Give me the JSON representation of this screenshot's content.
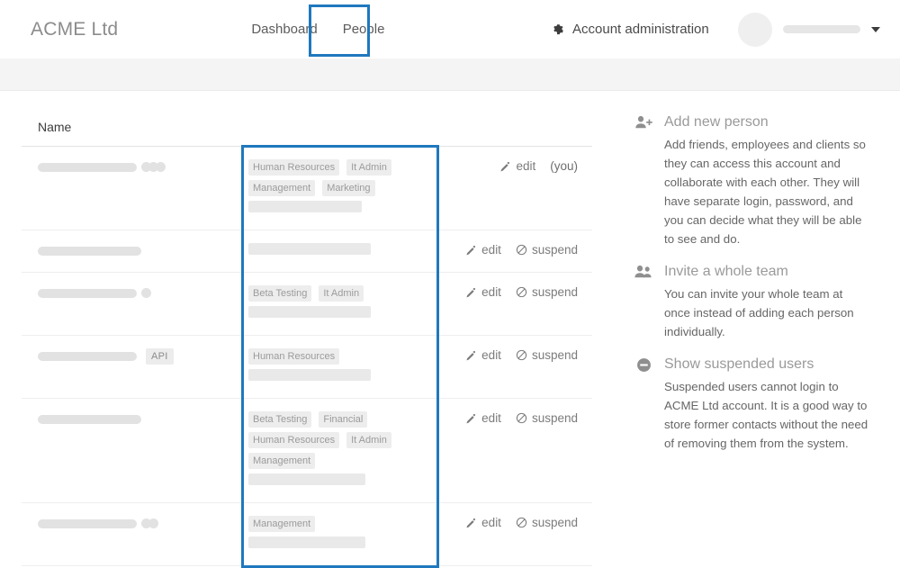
{
  "header": {
    "brand": "ACME Ltd",
    "nav": [
      {
        "label": "Dashboard",
        "active": false
      },
      {
        "label": "People",
        "active": true
      }
    ],
    "account_admin": {
      "label": "Account administration",
      "icon": "gear-icon"
    },
    "user_menu": {
      "avatar": "avatar",
      "name_redacted": true,
      "caret": "chevron-down-icon"
    }
  },
  "table": {
    "columns": [
      "Name"
    ],
    "rows": [
      {
        "name_redacted": true,
        "name_bar_width": 110,
        "name_dots": 3,
        "badge": "",
        "tags": [
          "Human Resources",
          "It Admin",
          "Management",
          "Marketing"
        ],
        "tag_redact_width": 126,
        "actions": {
          "edit": "edit",
          "suspend": "",
          "note": "(you)"
        }
      },
      {
        "name_redacted": true,
        "name_bar_width": 115,
        "name_dots": 0,
        "badge": "",
        "tags": [],
        "tag_redact_width": 136,
        "actions": {
          "edit": "edit",
          "suspend": "suspend",
          "note": ""
        }
      },
      {
        "name_redacted": true,
        "name_bar_width": 110,
        "name_dots": 1,
        "badge": "",
        "tags": [
          "Beta Testing",
          "It Admin"
        ],
        "tag_redact_width": 136,
        "actions": {
          "edit": "edit",
          "suspend": "suspend",
          "note": ""
        }
      },
      {
        "name_redacted": true,
        "name_bar_width": 110,
        "name_dots": 0,
        "badge": "API",
        "tags": [
          "Human Resources"
        ],
        "tag_redact_width": 136,
        "actions": {
          "edit": "edit",
          "suspend": "suspend",
          "note": ""
        }
      },
      {
        "name_redacted": true,
        "name_bar_width": 115,
        "name_dots": 0,
        "badge": "",
        "tags": [
          "Beta Testing",
          "Financial",
          "Human Resources",
          "It Admin",
          "Management"
        ],
        "tag_redact_width": 130,
        "actions": {
          "edit": "edit",
          "suspend": "suspend",
          "note": ""
        }
      },
      {
        "name_redacted": true,
        "name_bar_width": 110,
        "name_dots": 2,
        "badge": "",
        "tags": [
          "Management"
        ],
        "tag_redact_width": 130,
        "actions": {
          "edit": "edit",
          "suspend": "suspend",
          "note": ""
        }
      }
    ]
  },
  "sidebar": {
    "items": [
      {
        "icon": "user-plus-icon",
        "title": "Add new person",
        "body": "Add friends, employees and clients so they can access this account and collaborate with each other. They will have separate login, password, and you can decide what they will be able to see and do."
      },
      {
        "icon": "users-icon",
        "title": "Invite a whole team",
        "body": "You can invite your whole team at once instead of adding each person individually."
      },
      {
        "icon": "minus-circle-icon",
        "title": "Show suspended users",
        "body": "Suspended users cannot login to ACME Ltd account. It is a good way to store former contacts without the need of removing them from the system."
      }
    ]
  },
  "highlights": {
    "color": "#1f78bd",
    "tab_target": "People",
    "column_target": "tags-column"
  }
}
